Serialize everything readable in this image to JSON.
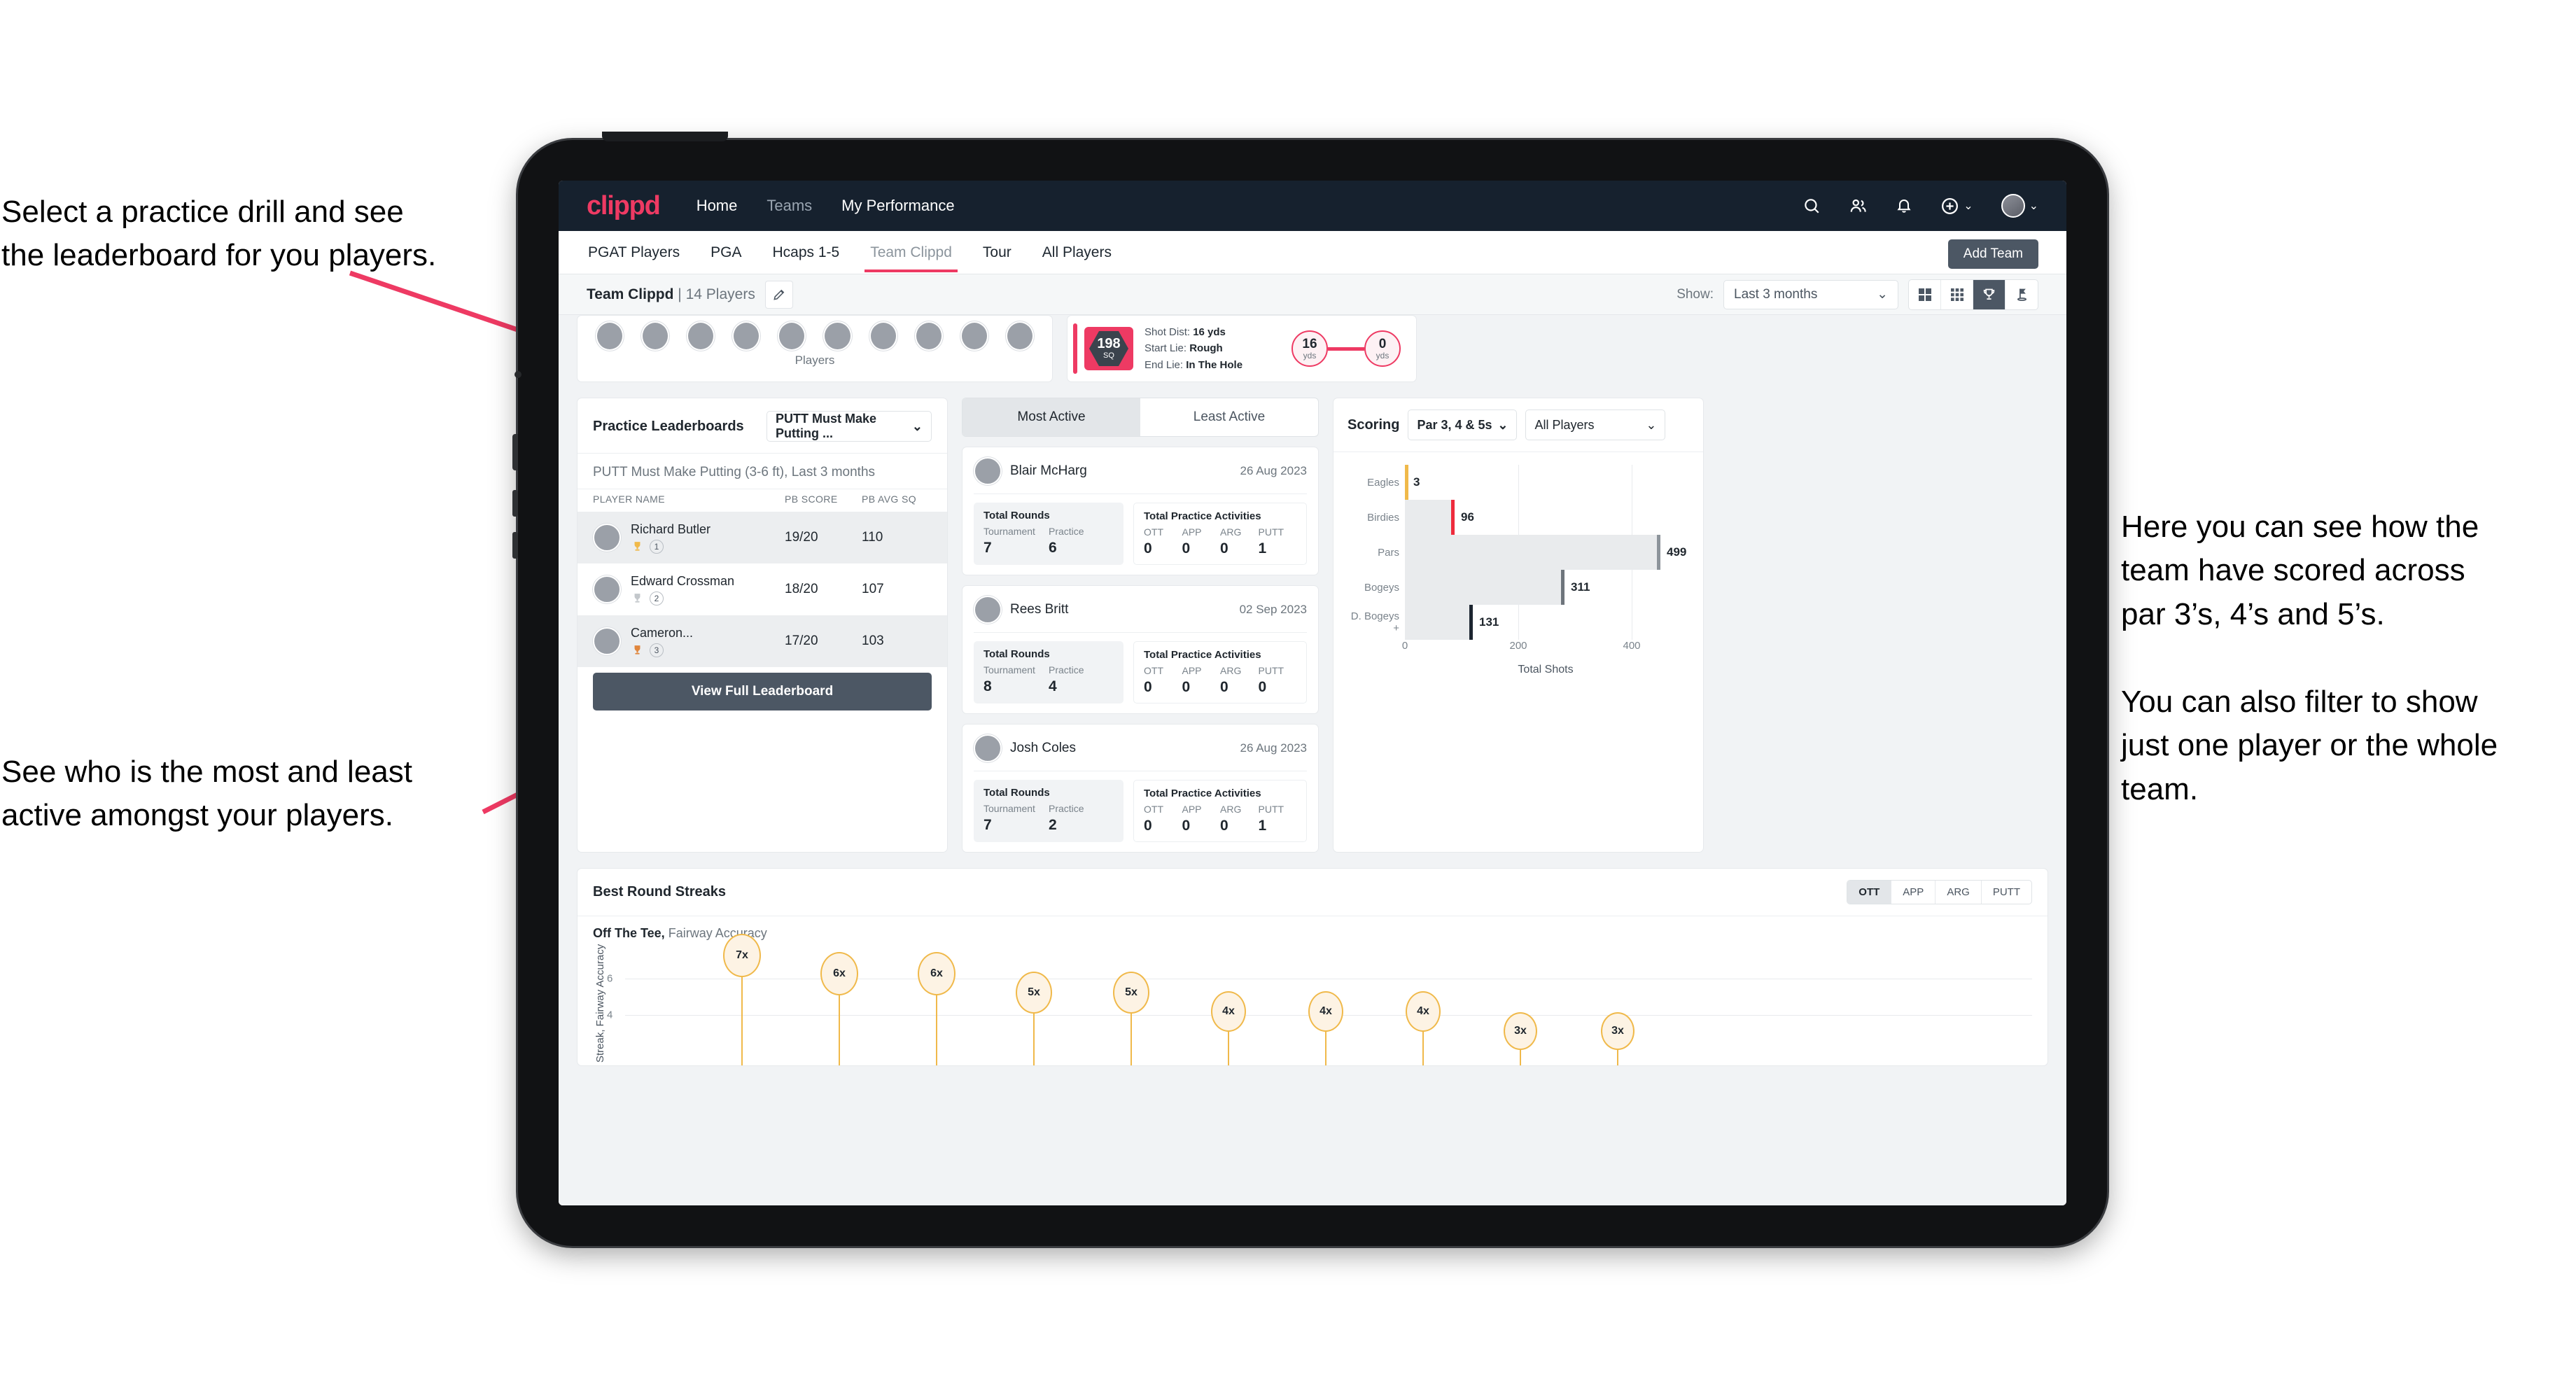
{
  "annotations": {
    "left_top": [
      "Select a practice drill and see",
      "the leaderboard for you players."
    ],
    "left_bottom": [
      "See who is the most and least",
      "active amongst your players."
    ],
    "right": [
      "Here you can see how the",
      "team have scored across",
      "par 3’s, 4’s and 5’s.",
      "You can also filter to show",
      "just one player or the whole",
      "team."
    ]
  },
  "colors": {
    "brand": "#ee3a63",
    "navbar": "#16212e",
    "slate": "#4c5764",
    "gold": "#f0b94a"
  },
  "navbar": {
    "logo": "clippd",
    "links": [
      {
        "label": "Home",
        "active": true
      },
      {
        "label": "Teams",
        "active": false
      },
      {
        "label": "My Performance",
        "active": true
      }
    ],
    "icons": [
      "search-icon",
      "people-icon",
      "bell-icon",
      "plus-circle-icon",
      "avatar"
    ]
  },
  "subtabs": {
    "items": [
      {
        "label": "PGAT Players",
        "active": false
      },
      {
        "label": "PGA",
        "active": false
      },
      {
        "label": "Hcaps 1-5",
        "active": false
      },
      {
        "label": "Team Clippd",
        "active": true
      },
      {
        "label": "Tour",
        "active": false
      },
      {
        "label": "All Players",
        "active": false
      }
    ],
    "add_team_label": "Add Team"
  },
  "toolbar": {
    "team_name": "Team Clippd",
    "separator": "|",
    "player_count": "14 Players",
    "edit_icon": "pencil-icon",
    "show_label": "Show:",
    "range_value": "Last 3 months",
    "view_buttons": [
      "grid-large-icon",
      "grid-small-icon",
      "trophy-icon",
      "flagstick-icon"
    ],
    "active_view": "trophy-icon"
  },
  "players_card": {
    "label": "Players",
    "avatar_count": 10
  },
  "shot_card": {
    "badge_value": "198",
    "badge_unit": "SQ",
    "lines": [
      {
        "label": "Shot Dist:",
        "value": "16 yds"
      },
      {
        "label": "Start Lie:",
        "value": "Rough"
      },
      {
        "label": "End Lie:",
        "value": "In The Hole"
      }
    ],
    "start_node": {
      "value": "16",
      "unit": "yds"
    },
    "end_node": {
      "value": "0",
      "unit": "yds"
    }
  },
  "practice_leaderboards": {
    "title": "Practice Leaderboards",
    "drill_select": "PUTT Must Make Putting ...",
    "subtitle_bold": "PUTT Must Make Putting (3-6 ft),",
    "subtitle_light": "Last 3 months",
    "columns": [
      "PLAYER NAME",
      "PB SCORE",
      "PB AVG SQ"
    ],
    "rows": [
      {
        "name": "Richard Butler",
        "rank": "1",
        "trophy": "gold",
        "score": "19/20",
        "sq": "110"
      },
      {
        "name": "Edward Crossman",
        "rank": "2",
        "trophy": "silver",
        "score": "18/20",
        "sq": "107"
      },
      {
        "name": "Cameron...",
        "rank": "3",
        "trophy": "bronze",
        "score": "17/20",
        "sq": "103"
      }
    ],
    "button_label": "View Full Leaderboard"
  },
  "activity": {
    "tabs": [
      {
        "label": "Most Active",
        "active": true
      },
      {
        "label": "Least Active",
        "active": false
      }
    ],
    "stat_group_rounds": "Total Rounds",
    "stat_group_practice": "Total Practice Activities",
    "rounds_labels": [
      "Tournament",
      "Practice"
    ],
    "practice_labels": [
      "OTT",
      "APP",
      "ARG",
      "PUTT"
    ],
    "items": [
      {
        "name": "Blair McHarg",
        "date": "26 Aug 2023",
        "rounds": [
          "7",
          "6"
        ],
        "practice": [
          "0",
          "0",
          "0",
          "1"
        ]
      },
      {
        "name": "Rees Britt",
        "date": "02 Sep 2023",
        "rounds": [
          "8",
          "4"
        ],
        "practice": [
          "0",
          "0",
          "0",
          "0"
        ]
      },
      {
        "name": "Josh Coles",
        "date": "26 Aug 2023",
        "rounds": [
          "7",
          "2"
        ],
        "practice": [
          "0",
          "0",
          "0",
          "1"
        ]
      }
    ]
  },
  "scoring": {
    "title": "Scoring",
    "par_filter": "Par 3, 4 & 5s",
    "player_filter": "All Players"
  },
  "streaks": {
    "title": "Best Round Streaks",
    "segments": [
      {
        "label": "OTT",
        "active": true
      },
      {
        "label": "APP",
        "active": false
      },
      {
        "label": "ARG",
        "active": false
      },
      {
        "label": "PUTT",
        "active": false
      }
    ],
    "sub_bold": "Off The Tee,",
    "sub_light": "Fairway Accuracy"
  },
  "chart_data": [
    {
      "type": "bar",
      "orientation": "horizontal",
      "title": "Scoring",
      "categories": [
        "Eagles",
        "Birdies",
        "Pars",
        "Bogeys",
        "D. Bogeys +"
      ],
      "values": [
        3,
        96,
        499,
        311,
        131
      ],
      "cap_colors": [
        "#f0b94a",
        "#ee2b3c",
        "#8d949b",
        "#6e757c",
        "#1c2530"
      ],
      "xlabel": "Total Shots",
      "ylabel": "",
      "xticks": [
        0,
        200,
        400
      ],
      "xlim": [
        0,
        540
      ],
      "grid": true,
      "legend": "none"
    },
    {
      "type": "scatter",
      "subtype": "lollipop",
      "title": "Best Round Streaks",
      "subtitle": "Off The Tee, Fairway Accuracy",
      "ylabel": "Streak, Fairway Accuracy",
      "yticks": [
        4,
        6
      ],
      "ylim": [
        0,
        7.8
      ],
      "categories": [
        "",
        "",
        "",
        "",
        "",
        "",
        "",
        "",
        "",
        "",
        ""
      ],
      "values": [
        7,
        6,
        6,
        5,
        5,
        4,
        4,
        4,
        3,
        3
      ],
      "point_labels": [
        "7x",
        "6x",
        "6x",
        "5x",
        "5x",
        "4x",
        "4x",
        "4x",
        "3x",
        "3x"
      ],
      "grid": true,
      "legend": "none"
    }
  ]
}
